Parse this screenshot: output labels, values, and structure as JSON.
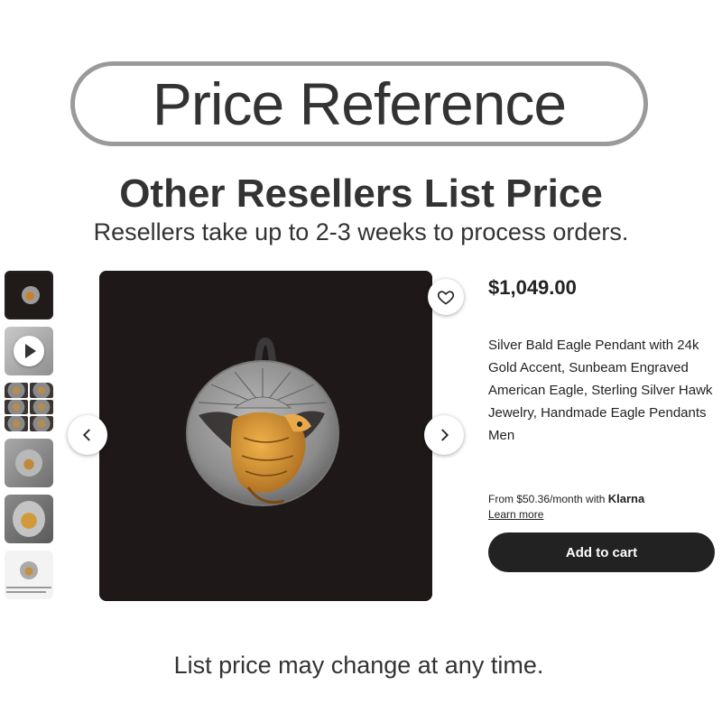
{
  "banner": {
    "title": "Price Reference"
  },
  "heading": "Other Resellers List Price",
  "subheading": "Resellers take up to 2-3 weeks to process orders.",
  "gallery": {
    "thumbnails": [
      "pendant-dark-photo",
      "video",
      "pendant-grid",
      "pendant-in-hand",
      "pendant-in-hand-closeup",
      "pendant-white-background"
    ],
    "main_image": "silver-eagle-pendant-photo"
  },
  "product": {
    "price": "$1,049.00",
    "title": "Silver Bald Eagle Pendant with 24k Gold Accent, Sunbeam Engraved American Eagle, Sterling Silver Hawk Jewelry, Handmade Eagle Pendants Men",
    "klarna_text": "From $50.36/month with",
    "klarna_brand": "Klarna",
    "learn_more": "Learn more",
    "add_to_cart": "Add to cart"
  },
  "footer": "List price may change at any time.",
  "colors": {
    "button": "#222222",
    "photo_background": "#1e1918",
    "pill_border": "#9a9a9a",
    "gold_accent": "#c9822a"
  }
}
